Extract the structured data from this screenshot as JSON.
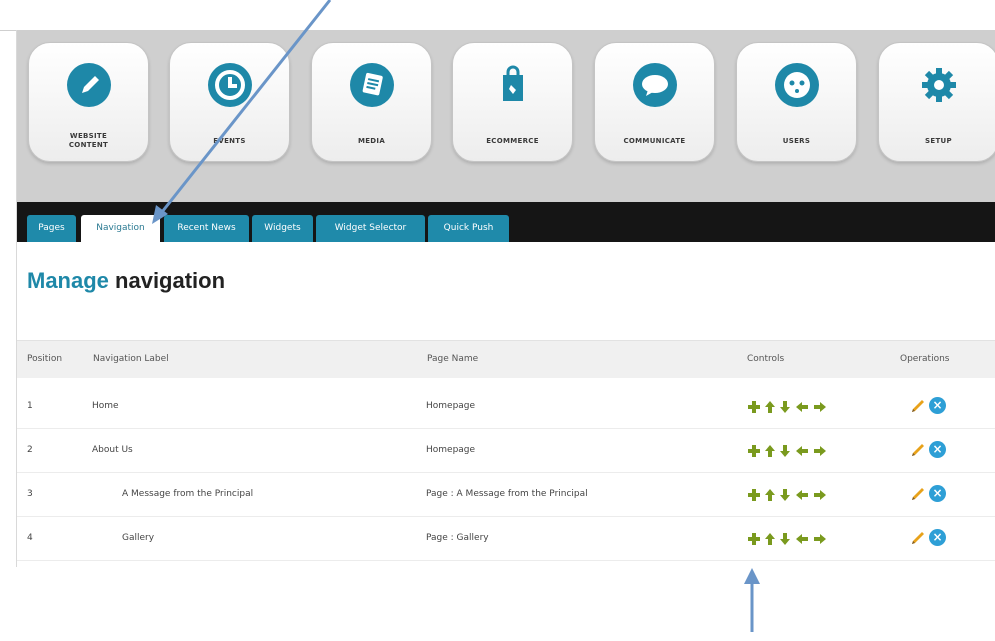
{
  "modules": [
    {
      "label_lines": [
        "WEBSITE",
        "CONTENT"
      ],
      "icon": "pencil-icon"
    },
    {
      "label_lines": [
        "EVENTS"
      ],
      "icon": "clock-icon"
    },
    {
      "label_lines": [
        "MEDIA"
      ],
      "icon": "document-icon"
    },
    {
      "label_lines": [
        "ECOMMERCE"
      ],
      "icon": "shopping-bag-icon"
    },
    {
      "label_lines": [
        "COMMUNICATE"
      ],
      "icon": "speech-bubble-icon"
    },
    {
      "label_lines": [
        "USERS"
      ],
      "icon": "face-icon"
    },
    {
      "label_lines": [
        "SETUP"
      ],
      "icon": "gear-icon"
    }
  ],
  "tabs": [
    "Pages",
    "Navigation",
    "Recent News",
    "Widgets",
    "Widget Selector",
    "Quick Push"
  ],
  "active_tab": "Navigation",
  "heading": {
    "highlight": "Manage",
    "rest": " navigation"
  },
  "table": {
    "headers": [
      "Position",
      "Navigation Label",
      "Page Name",
      "Controls",
      "Operations"
    ],
    "rows": [
      {
        "position": "1",
        "label": "Home",
        "page": "Homepage"
      },
      {
        "position": "2",
        "label": "About Us",
        "page": "Homepage"
      },
      {
        "position": "3",
        "label": "A Message from the Principal",
        "page": "Page : A Message from the Principal"
      },
      {
        "position": "4",
        "label": "Gallery",
        "page": "Page : Gallery"
      }
    ]
  },
  "controls": [
    "add-icon",
    "move-up-icon",
    "move-down-icon",
    "outdent-icon",
    "indent-icon"
  ],
  "operations": [
    "edit-icon",
    "delete-icon"
  ],
  "colors": {
    "accent": "#1e88a8",
    "tab_bar": "#151515",
    "control_green": "#7a9a1e",
    "edit_orange": "#e8a21a",
    "delete_blue": "#2e9fd6",
    "annotation_arrow": "#6a95c8"
  }
}
